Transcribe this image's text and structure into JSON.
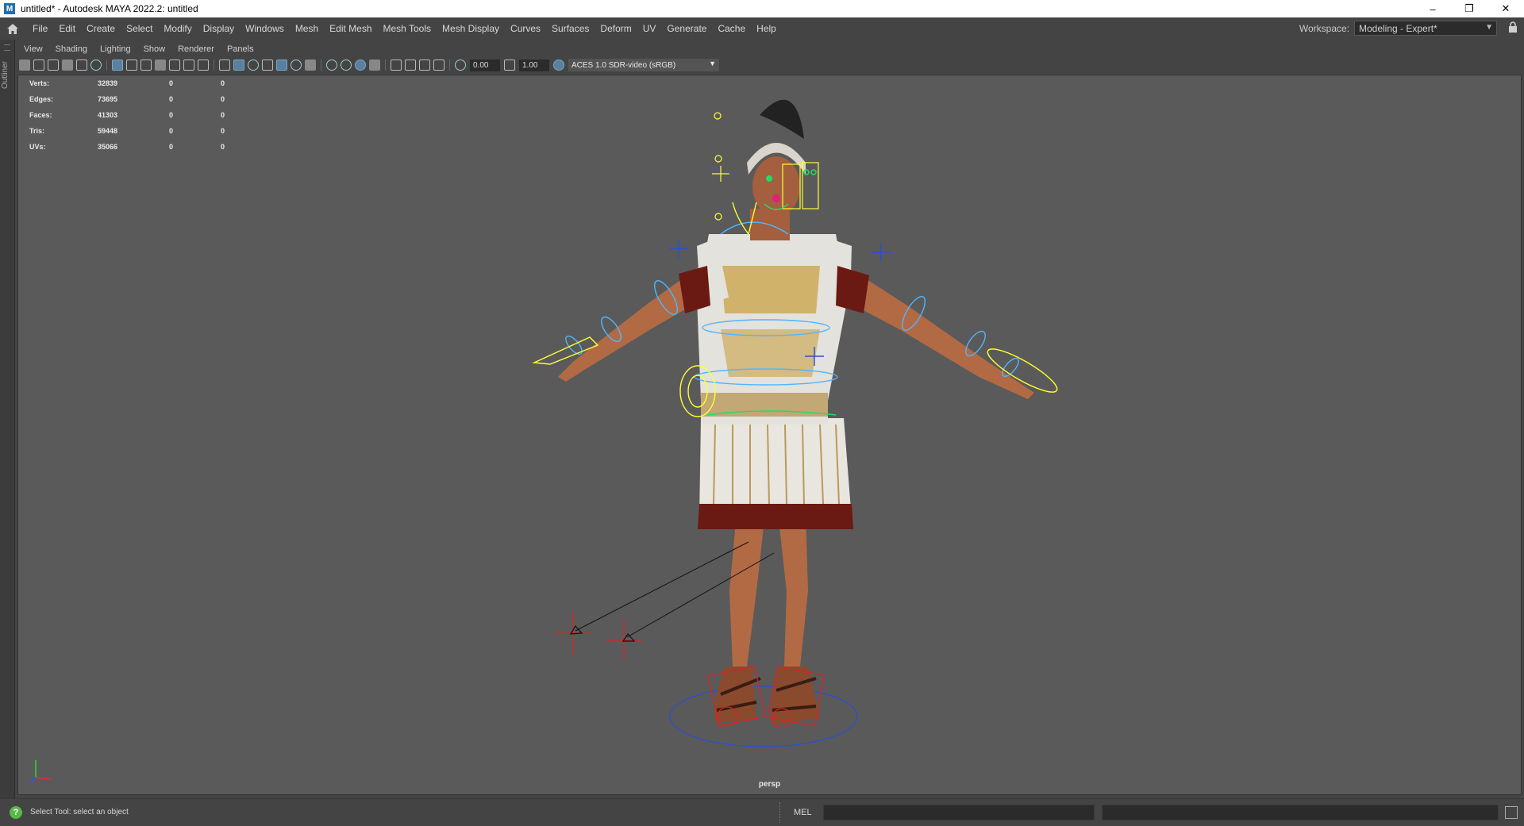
{
  "window": {
    "app_icon_letter": "M",
    "title": "untitled* - Autodesk MAYA 2022.2: untitled",
    "controls": [
      "–",
      "❐",
      "✕"
    ]
  },
  "menubar": {
    "items": [
      "File",
      "Edit",
      "Create",
      "Select",
      "Modify",
      "Display",
      "Windows",
      "Mesh",
      "Edit Mesh",
      "Mesh Tools",
      "Mesh Display",
      "Curves",
      "Surfaces",
      "Deform",
      "UV",
      "Generate",
      "Cache",
      "Help"
    ],
    "workspace_label": "Workspace:",
    "workspace_value": "Modeling - Expert*"
  },
  "outliner_tab": {
    "label": "Outliner"
  },
  "panel_menu": {
    "items": [
      "View",
      "Shading",
      "Lighting",
      "Show",
      "Renderer",
      "Panels"
    ]
  },
  "panel_toolbar": {
    "exposure": "0.00",
    "gamma": "1.00",
    "color_space": "ACES 1.0 SDR-video (sRGB)"
  },
  "hud": {
    "rows": [
      {
        "label": "Verts:",
        "v1": "32839",
        "v2": "0",
        "v3": "0"
      },
      {
        "label": "Edges:",
        "v1": "73695",
        "v2": "0",
        "v3": "0"
      },
      {
        "label": "Faces:",
        "v1": "41303",
        "v2": "0",
        "v3": "0"
      },
      {
        "label": "Tris:",
        "v1": "59448",
        "v2": "0",
        "v3": "0"
      },
      {
        "label": "UVs:",
        "v1": "35066",
        "v2": "0",
        "v3": "0"
      }
    ]
  },
  "viewport": {
    "camera": "persp",
    "background": "#5a5a5a"
  },
  "statusbar": {
    "help_text": "Select Tool: select an object",
    "mel_label": "MEL",
    "command_value": ""
  },
  "colors": {
    "ui_bg": "#444444",
    "viewport_bg": "#5a5a5a",
    "ctrl_yellow": "#ffff33",
    "ctrl_blue": "#4fb6ff",
    "ctrl_red": "#e02020"
  }
}
